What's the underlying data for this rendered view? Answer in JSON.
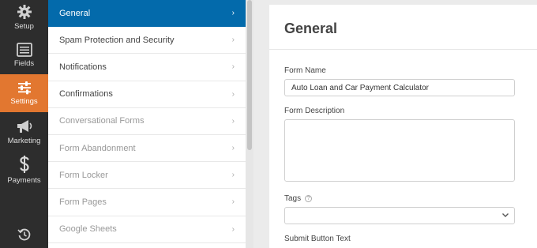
{
  "rail": {
    "items": [
      {
        "label": "Setup",
        "icon": "gear-icon"
      },
      {
        "label": "Fields",
        "icon": "fields-list-icon"
      },
      {
        "label": "Settings",
        "icon": "sliders-icon",
        "active": true
      },
      {
        "label": "Marketing",
        "icon": "megaphone-icon"
      },
      {
        "label": "Payments",
        "icon": "dollar-icon"
      }
    ],
    "bottom_icon": "revisions-history-icon"
  },
  "menu": {
    "items": [
      {
        "label": "General",
        "state": "active"
      },
      {
        "label": "Spam Protection and Security",
        "state": "normal"
      },
      {
        "label": "Notifications",
        "state": "normal"
      },
      {
        "label": "Confirmations",
        "state": "normal"
      },
      {
        "label": "Conversational Forms",
        "state": "dim"
      },
      {
        "label": "Form Abandonment",
        "state": "dim"
      },
      {
        "label": "Form Locker",
        "state": "dim"
      },
      {
        "label": "Form Pages",
        "state": "dim"
      },
      {
        "label": "Google Sheets",
        "state": "dim"
      }
    ],
    "chevron": "›"
  },
  "panel": {
    "title": "General",
    "form_name_label": "Form Name",
    "form_name_value": "Auto Loan and Car Payment Calculator",
    "form_description_label": "Form Description",
    "tags_label": "Tags",
    "tags_help": "?",
    "submit_button_text_label": "Submit Button Text"
  },
  "colors": {
    "rail_bg": "#2d2d2d",
    "rail_active": "#e27730",
    "menu_active": "#036aab"
  }
}
